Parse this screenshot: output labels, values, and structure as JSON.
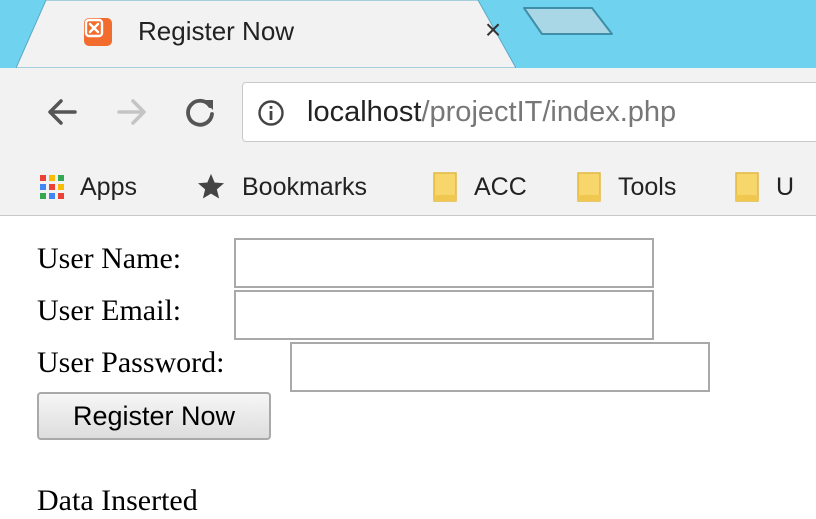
{
  "tab": {
    "title": "Register Now",
    "close_symbol": "×",
    "favicon": "xampp-icon"
  },
  "toolbar": {
    "back_icon": "back-arrow-icon",
    "forward_icon": "forward-arrow-icon",
    "reload_icon": "reload-icon",
    "url_host": "localhost",
    "url_path": "/projectIT/index.php"
  },
  "bookmarks": [
    {
      "label": "Apps",
      "icon": "apps-grid-icon"
    },
    {
      "label": "Bookmarks",
      "icon": "star-icon"
    },
    {
      "label": "ACC",
      "icon": "folder-icon"
    },
    {
      "label": "Tools",
      "icon": "folder-icon"
    },
    {
      "label": "U",
      "icon": "folder-icon"
    }
  ],
  "form": {
    "username_label": "User Name:",
    "username_value": "",
    "email_label": "User Email:",
    "email_value": "",
    "password_label": "User Password:",
    "password_value": "",
    "submit_label": "Register Now"
  },
  "status_message": "Data Inserted",
  "colors": {
    "tabstrip": "#6fd2ef",
    "toolbar": "#f2f2f2",
    "favicon": "#f26d2d",
    "folder": "#f7d66c"
  }
}
